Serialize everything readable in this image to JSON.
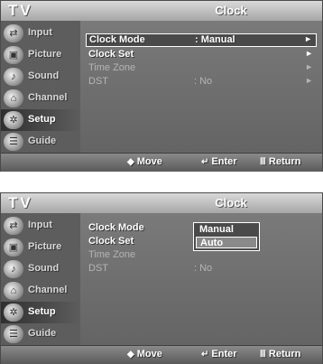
{
  "app_title": "TV",
  "screen_title": "Clock",
  "sidebar": [
    {
      "label": "Input",
      "icon": "input-icon",
      "glyph": "⇄"
    },
    {
      "label": "Picture",
      "icon": "picture-icon",
      "glyph": "▣"
    },
    {
      "label": "Sound",
      "icon": "sound-icon",
      "glyph": "♪"
    },
    {
      "label": "Channel",
      "icon": "channel-icon",
      "glyph": "⌂"
    },
    {
      "label": "Setup",
      "icon": "setup-icon",
      "glyph": "✲"
    },
    {
      "label": "Guide",
      "icon": "guide-icon",
      "glyph": "☰"
    }
  ],
  "active_sidebar": "Setup",
  "menu_rows": [
    {
      "name": "Clock Mode",
      "value": ": Manual",
      "arrow": "►"
    },
    {
      "name": "Clock Set",
      "value": "",
      "arrow": "►"
    },
    {
      "name": "Time Zone",
      "value": "",
      "arrow": "►"
    },
    {
      "name": "DST",
      "value": ": No",
      "arrow": "►"
    }
  ],
  "panel2_rows": [
    {
      "name": "Clock Mode",
      "value": ":"
    },
    {
      "name": "Clock Set",
      "value": ""
    },
    {
      "name": "Time Zone",
      "value": ""
    },
    {
      "name": "DST",
      "value": ": No"
    }
  ],
  "dropdown": {
    "options": [
      "Manual",
      "Auto"
    ],
    "highlighted": "Auto"
  },
  "footer": {
    "move_glyph": "◆",
    "move_label": "Move",
    "enter_glyph": "↵",
    "enter_label": "Enter",
    "return_glyph": "Ⅲ",
    "return_label": "Return"
  },
  "colors": {
    "panel_bg": "#6b6b6b",
    "selection_border": "#ffffff",
    "dim_text": "#b5b5b5"
  }
}
